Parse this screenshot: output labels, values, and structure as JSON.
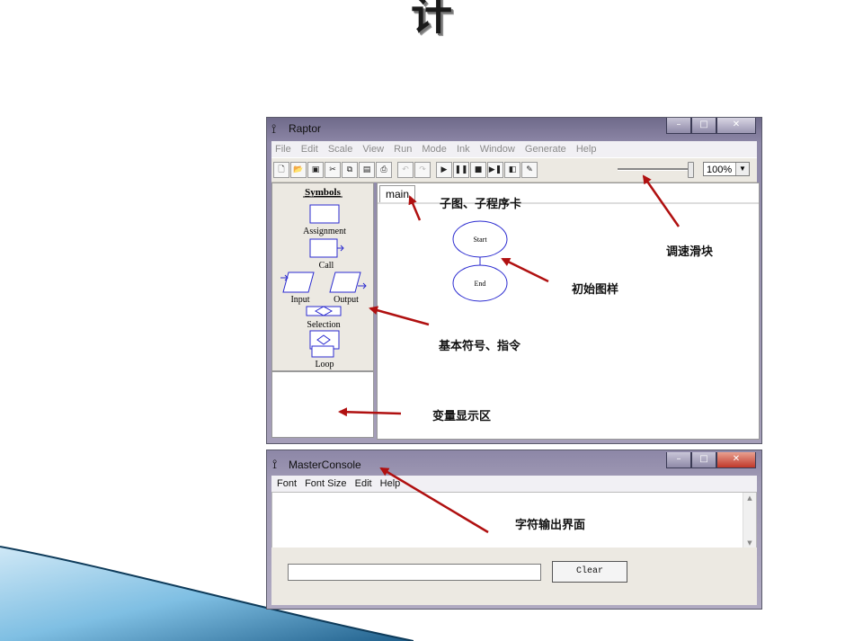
{
  "slide": {
    "title_vertical": "程序设计"
  },
  "raptor": {
    "title": "Raptor",
    "menu": [
      "File",
      "Edit",
      "Scale",
      "View",
      "Run",
      "Mode",
      "Ink",
      "Window",
      "Generate",
      "Help"
    ],
    "zoom": "100%",
    "symbols_header": "Symbols",
    "symbols": [
      "Assignment",
      "Call",
      "Input",
      "Output",
      "Selection",
      "Loop"
    ],
    "tab": "main",
    "flowchart": {
      "start": "Start",
      "end": "End"
    }
  },
  "console": {
    "title": "MasterConsole",
    "menu": [
      "Font",
      "Font Size",
      "Edit",
      "Help"
    ],
    "clear_label": "Clear"
  },
  "annotations": {
    "subchart": "子图、子程序卡",
    "speed_slider": "调速滑块",
    "initial_chart": "初始图样",
    "basic_symbols": "基本符号、指令",
    "variable_area": "变量显示区",
    "output_area": "字符输出界面"
  },
  "colors": {
    "arrow": "#b01010",
    "flow": "#2b2bd0",
    "swoosh_dark": "#1f5f8b",
    "swoosh_light": "#9fd0ec"
  }
}
